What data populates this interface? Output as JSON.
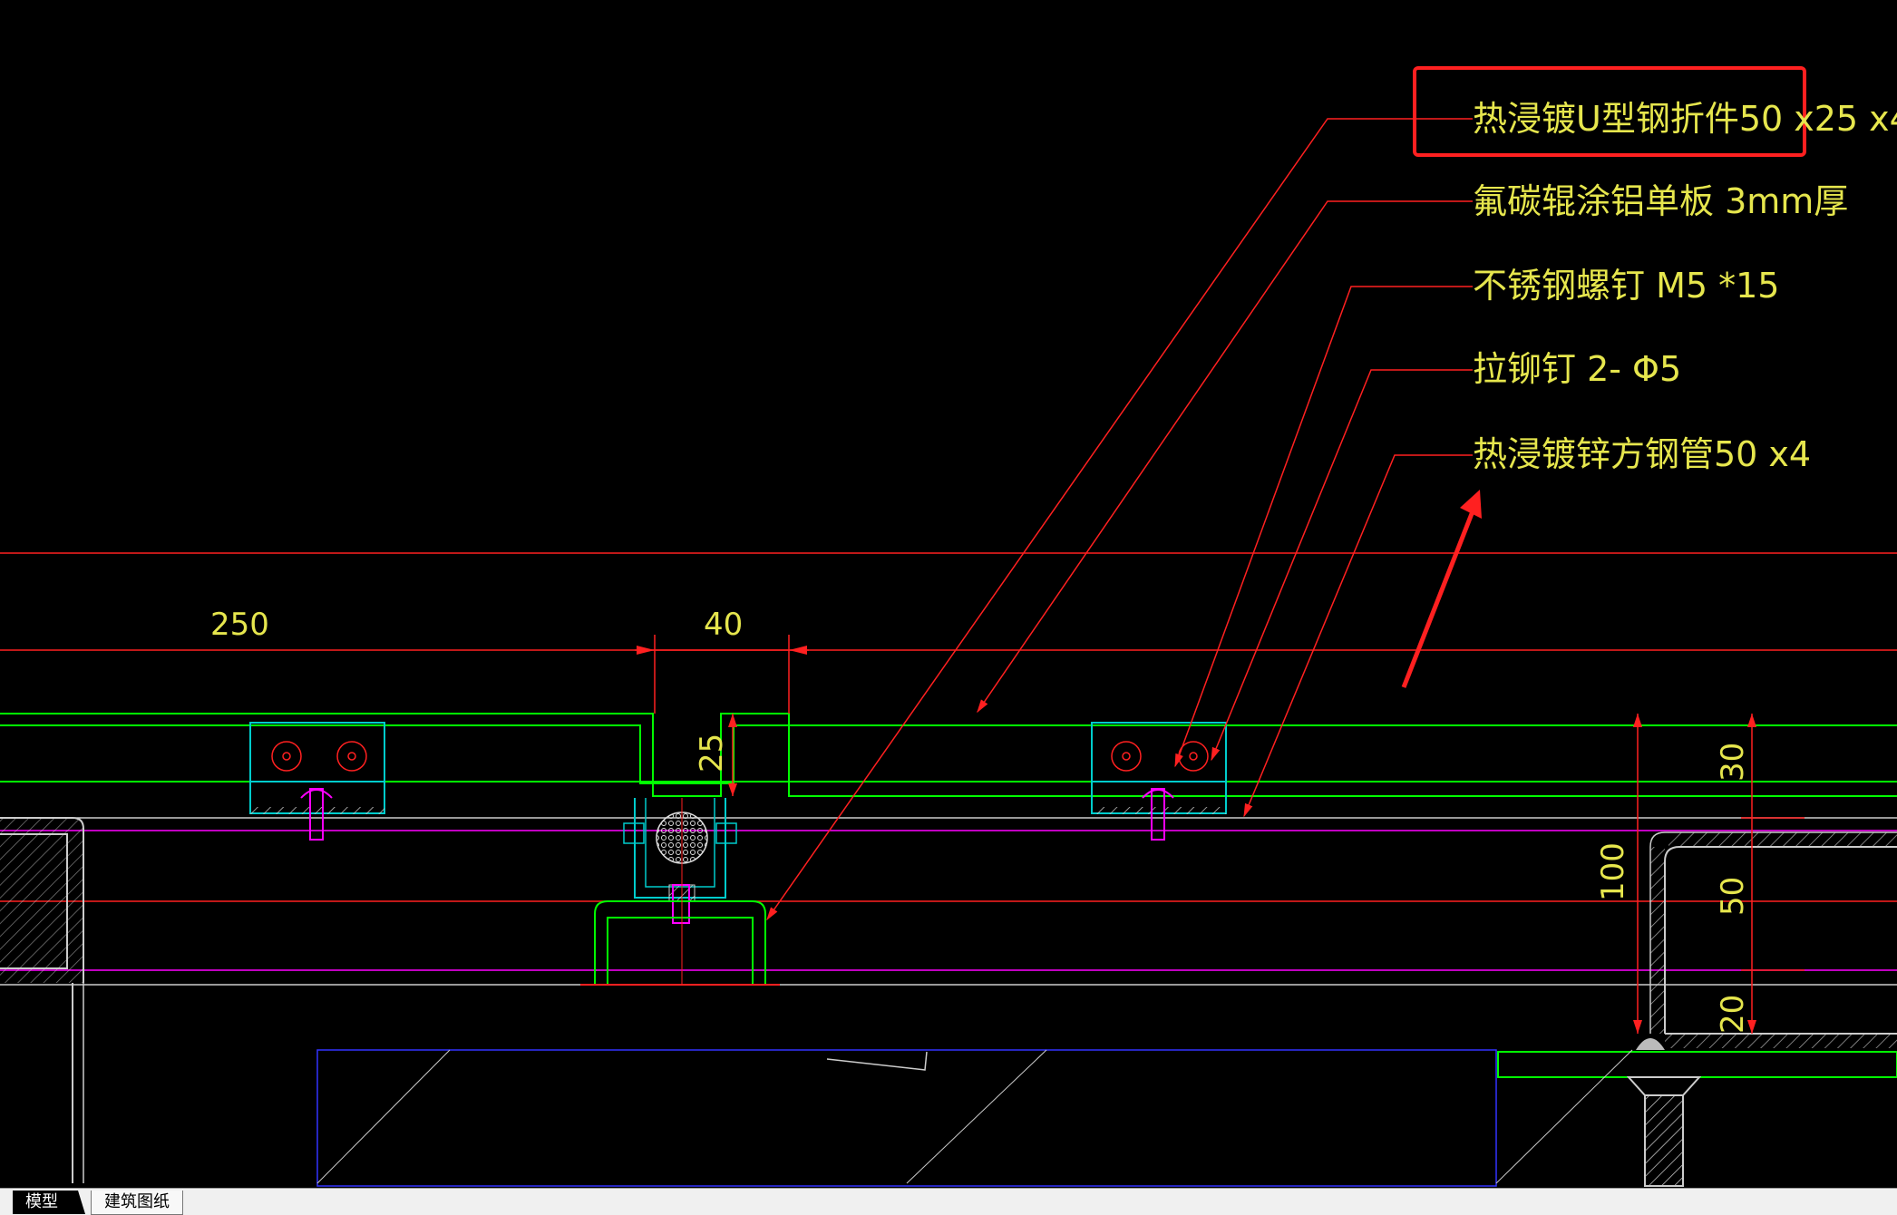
{
  "annotations": [
    {
      "text": "热浸镀U型钢折件50 x25 x4",
      "highlighted": true
    },
    {
      "text": "氟碳辊涂铝单板 3mm厚",
      "highlighted": false
    },
    {
      "text": "不锈钢螺钉 M5 *15",
      "highlighted": false
    },
    {
      "text": "拉铆钉 2- Φ5",
      "highlighted": false
    },
    {
      "text": "热浸镀锌方钢管50 x4",
      "highlighted": false
    }
  ],
  "dimensions": {
    "d250": "250",
    "d40": "40",
    "d25": "25",
    "d30": "30",
    "d100": "100",
    "d50": "50",
    "d20": "20"
  },
  "tabs": {
    "model": "模型",
    "sheet": "建筑图纸"
  },
  "colors": {
    "background": "#000000",
    "annotation_text": "#e6e64d",
    "leader": "#ff2020",
    "panel": "#00ff00",
    "profile": "#00cccc",
    "centerline": "#ff00ff",
    "highlight_box": "#ff2020"
  }
}
